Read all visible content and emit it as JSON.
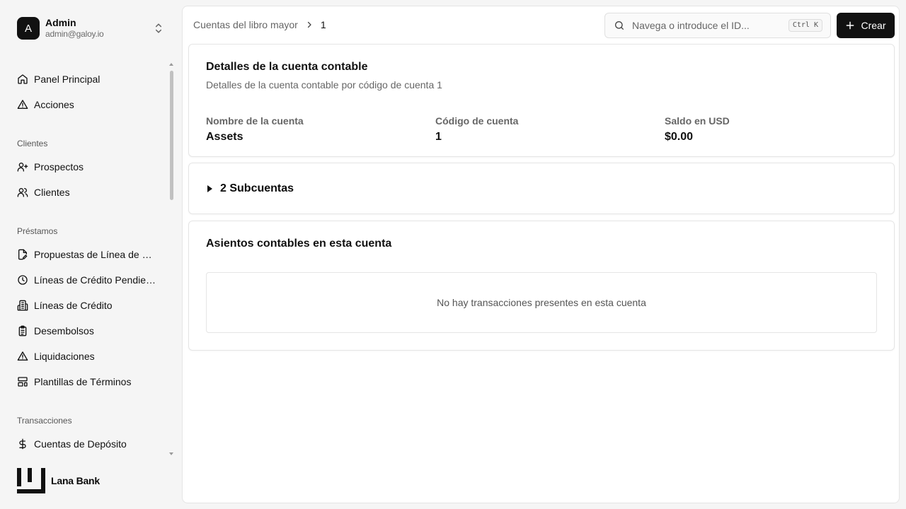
{
  "user": {
    "initial": "A",
    "name": "Admin",
    "email": "admin@galoy.io"
  },
  "sidebar": {
    "items_top": [
      {
        "label": "Panel Principal",
        "icon": "home-icon"
      },
      {
        "label": "Acciones",
        "icon": "alert-triangle-icon"
      }
    ],
    "groups": [
      {
        "label": "Clientes",
        "items": [
          {
            "label": "Prospectos",
            "icon": "user-plus-icon"
          },
          {
            "label": "Clientes",
            "icon": "users-icon"
          }
        ]
      },
      {
        "label": "Préstamos",
        "items": [
          {
            "label": "Propuestas de Línea de Cr...",
            "icon": "file-edit-icon"
          },
          {
            "label": "Líneas de Crédito Pendient...",
            "icon": "clock-icon"
          },
          {
            "label": "Líneas de Crédito",
            "icon": "building-icon"
          },
          {
            "label": "Desembolsos",
            "icon": "clipboard-list-icon"
          },
          {
            "label": "Liquidaciones",
            "icon": "alert-triangle-icon"
          },
          {
            "label": "Plantillas de Términos",
            "icon": "layout-template-icon"
          }
        ]
      },
      {
        "label": "Transacciones",
        "items": [
          {
            "label": "Cuentas de Depósito",
            "icon": "dollar-icon"
          }
        ]
      }
    ]
  },
  "brand": {
    "name": "Lana Bank"
  },
  "breadcrumb": {
    "parent": "Cuentas del libro mayor",
    "current": "1"
  },
  "search": {
    "placeholder": "Navega o introduce el ID...",
    "shortcut": "Ctrl K"
  },
  "create_button": {
    "label": "Crear"
  },
  "details": {
    "title": "Detalles de la cuenta contable",
    "description": "Detalles de la cuenta contable por código de cuenta 1",
    "fields": [
      {
        "label": "Nombre de la cuenta",
        "value": "Assets"
      },
      {
        "label": "Código de cuenta",
        "value": "1"
      },
      {
        "label": "Saldo en USD",
        "value": "$0.00"
      }
    ]
  },
  "subaccounts": {
    "label": "2 Subcuentas"
  },
  "entries": {
    "title": "Asientos contables en esta cuenta",
    "empty_text": "No hay transacciones presentes en esta cuenta"
  }
}
